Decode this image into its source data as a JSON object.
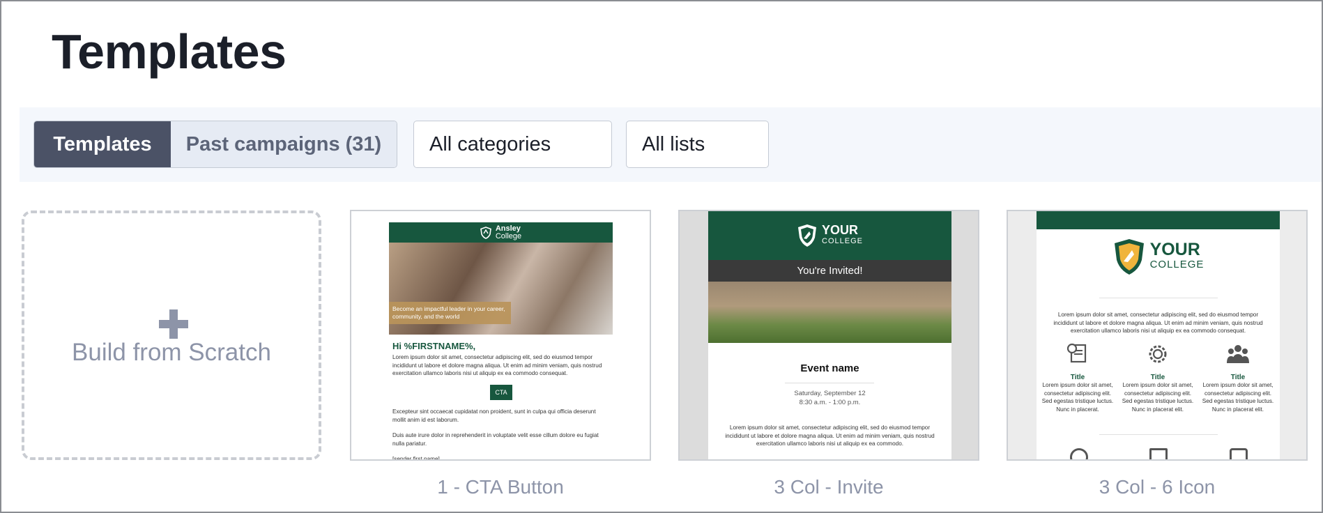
{
  "page": {
    "title": "Templates"
  },
  "toolbar": {
    "tabs": [
      {
        "label": "Templates",
        "active": true
      },
      {
        "label": "Past campaigns (31)",
        "active": false
      }
    ],
    "category_select": "All categories",
    "list_select": "All lists"
  },
  "scratch": {
    "label": "Build from Scratch",
    "icon": "plus-icon"
  },
  "templates": [
    {
      "caption": "1 - CTA Button",
      "preview": {
        "brand_top": "Ansley",
        "brand_bottom": "College",
        "banner": "Become an impactful leader in your career, community, and the world",
        "greeting": "Hi %FIRSTNAME%,",
        "para1": "Lorem ipsum dolor sit amet, consectetur adipiscing elit, sed do eiusmod tempor incididunt ut labore et dolore magna aliqua. Ut enim ad minim veniam, quis nostrud exercitation ullamco laboris nisi ut aliquip ex ea commodo consequat.",
        "cta": "CTA",
        "para2": "Excepteur sint occaecat cupidatat non proident, sunt in culpa qui officia deserunt mollit anim id est laborum.",
        "para3": "Duis aute irure dolor in reprehenderit in voluptate velit esse cillum dolore eu fugiat nulla pariatur.",
        "signature": "[sender first name]"
      }
    },
    {
      "caption": "3 Col - Invite",
      "preview": {
        "brand_top": "YOUR",
        "brand_bottom": "COLLEGE",
        "invited": "You're Invited!",
        "event_name": "Event name",
        "date": "Saturday, September 12",
        "time": "8:30 a.m. - 1:00 p.m.",
        "para": "Lorem ipsum dolor sit amet, consectetur adipiscing elit, sed do eiusmod tempor incididunt ut labore et dolore magna aliqua. Ut enim ad minim veniam, quis nostrud exercitation ullamco laboris nisi ut aliquip ex ea commodo."
      }
    },
    {
      "caption": "3 Col - 6 Icon",
      "preview": {
        "brand_top": "YOUR",
        "brand_bottom": "COLLEGE",
        "para": "Lorem ipsum dolor sit amet, consectetur adipiscing elit, sed do eiusmod tempor incididunt ut labore et dolore magna aliqua. Ut enim ad minim veniam, quis nostrud exercitation ullamco laboris nisi ut aliquip ex ea commodo consequat.",
        "columns": [
          {
            "icon": "certificate-icon",
            "title": "Title",
            "text": "Lorem ipsum dolor sit amet, consectetur adipiscing elit. Sed egestas tristique luctus. Nunc in placerat."
          },
          {
            "icon": "gear-check-icon",
            "title": "Title",
            "text": "Lorem ipsum dolor sit amet, consectetur adipiscing elit. Sed egestas tristique luctus. Nunc in placerat elit."
          },
          {
            "icon": "group-icon",
            "title": "Title",
            "text": "Lorem ipsum dolor sit amet, consectetur adipiscing elit. Sed egestas tristique luctus. Nunc in placerat elit."
          }
        ]
      }
    }
  ],
  "colors": {
    "brand_green": "#17573e",
    "tab_active": "#4b5266",
    "muted_text": "#8d94a8"
  }
}
